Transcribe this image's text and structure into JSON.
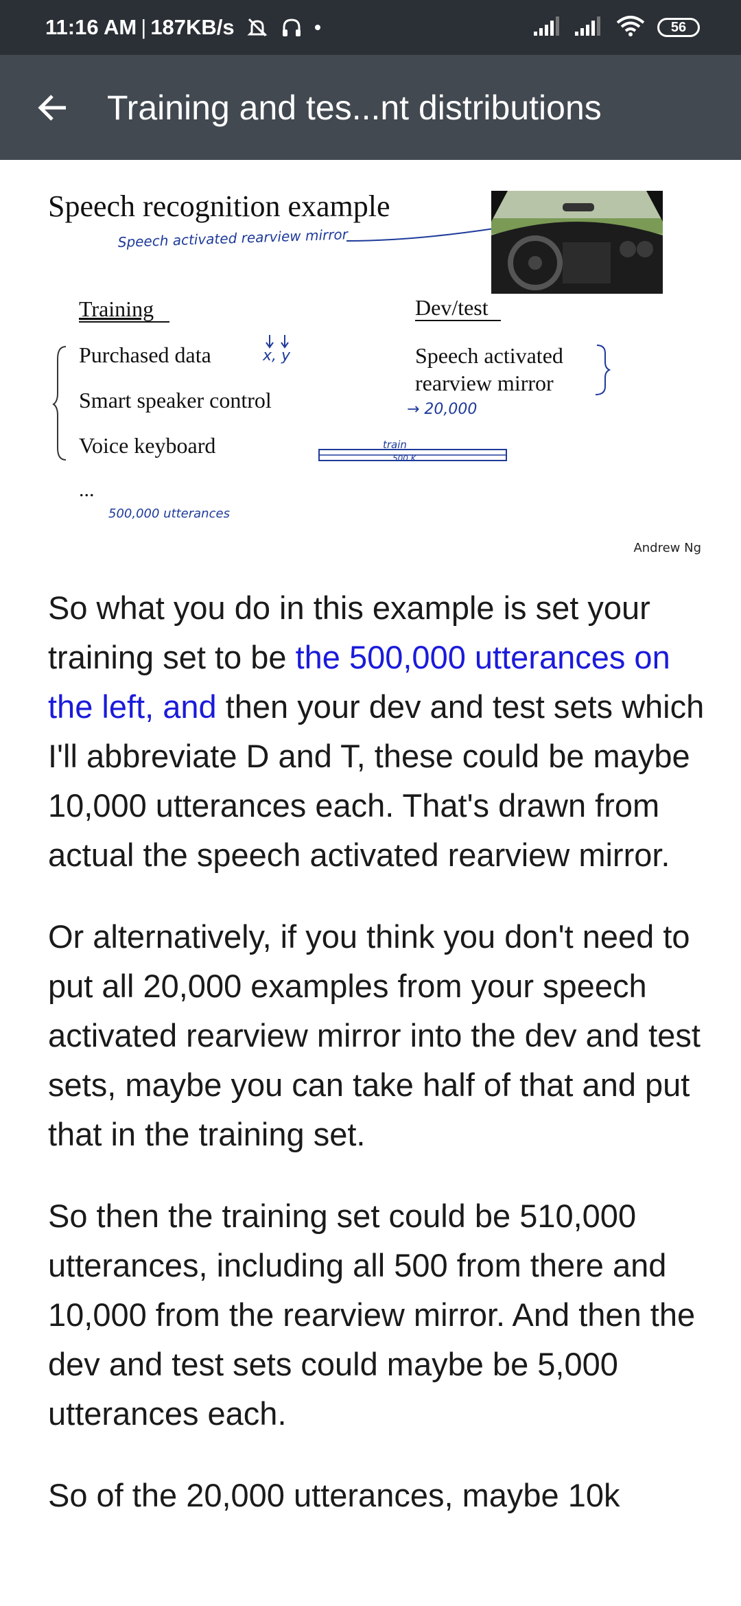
{
  "status_bar": {
    "time": "11:16 AM",
    "speed": "187KB/s",
    "battery": "56",
    "icons": [
      "mute-notification-icon",
      "headset-icon",
      "dot-icon",
      "signal-icon",
      "signal-icon",
      "wifi-icon",
      "battery-icon"
    ]
  },
  "app_bar": {
    "back_icon": "arrow-left-icon",
    "title": "Training and tes...nt distributions"
  },
  "slide": {
    "title": "Speech recognition example",
    "annotation_top": "Speech activated rearview mirror",
    "image_description_name": "car-interior-photo",
    "training_header": "Training",
    "training_items": [
      "Purchased data",
      "Smart speaker control",
      "Voice keyboard",
      "..."
    ],
    "xy_note": "x, y",
    "training_count_note": "500,000 utterances",
    "devtest_header": "Dev/test",
    "devtest_item_line1": "Speech activated",
    "devtest_item_line2": "rearview mirror",
    "devtest_count_note": "→ 20,000",
    "train_label": "train",
    "train_size": "500 K",
    "author": "Andrew Ng"
  },
  "article": {
    "p1_before": "So what you do in this example is set your training set to be ",
    "p1_highlight": "the 500,000 utterances on the left, and",
    "p1_after": " then your dev and test sets which I'll abbreviate D and T, these could be maybe 10,000 utterances each. That's drawn from actual the speech activated rearview mirror.",
    "p2": "Or alternatively, if you think you don't need to put all 20,000 examples from your speech activated rearview mirror into the dev and test sets, maybe you can take half of that and put that in the training set.",
    "p3": "So then the training set could be 510,000 utterances, including all 500 from there and 10,000 from the rearview mirror. And then the dev and test sets could maybe be 5,000 utterances each.",
    "p4": "So of the 20,000 utterances, maybe 10k"
  },
  "colors": {
    "status_bar": "#2b3036",
    "app_bar": "#424950",
    "highlight": "#1a1adb",
    "handwriting": "#1e3a9a"
  }
}
